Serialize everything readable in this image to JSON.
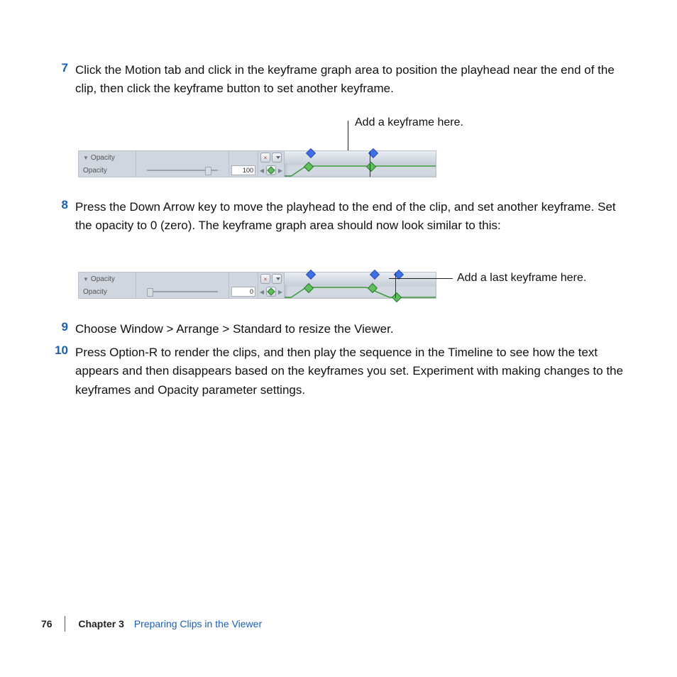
{
  "steps": {
    "s7": {
      "num": "7",
      "text": "Click the Motion tab and click in the keyframe graph area to position the playhead near the end of the clip, then click the keyframe button to set another keyframe."
    },
    "s8": {
      "num": "8",
      "text": "Press the Down Arrow key to move the playhead to the end of the clip, and set another keyframe. Set the opacity to 0 (zero). The keyframe graph area should now look similar to this:"
    },
    "s9": {
      "num": "9",
      "text": "Choose Window > Arrange > Standard to resize the Viewer."
    },
    "s10": {
      "num": "10",
      "text": "Press Option-R to render the clips, and then play the sequence in the Timeline to see how the text appears and then disappears based on the keyframes you set. Experiment with making changes to the keyframes and Opacity parameter settings."
    }
  },
  "panel_labels": {
    "header": "Opacity",
    "row": "Opacity"
  },
  "panel_values": {
    "img1": "100",
    "img2": "0"
  },
  "callouts": {
    "c1": "Add a keyframe here.",
    "c2": "Add a last keyframe here."
  },
  "footer": {
    "page": "76",
    "chapter": "Chapter 3",
    "title": "Preparing Clips in the Viewer"
  }
}
